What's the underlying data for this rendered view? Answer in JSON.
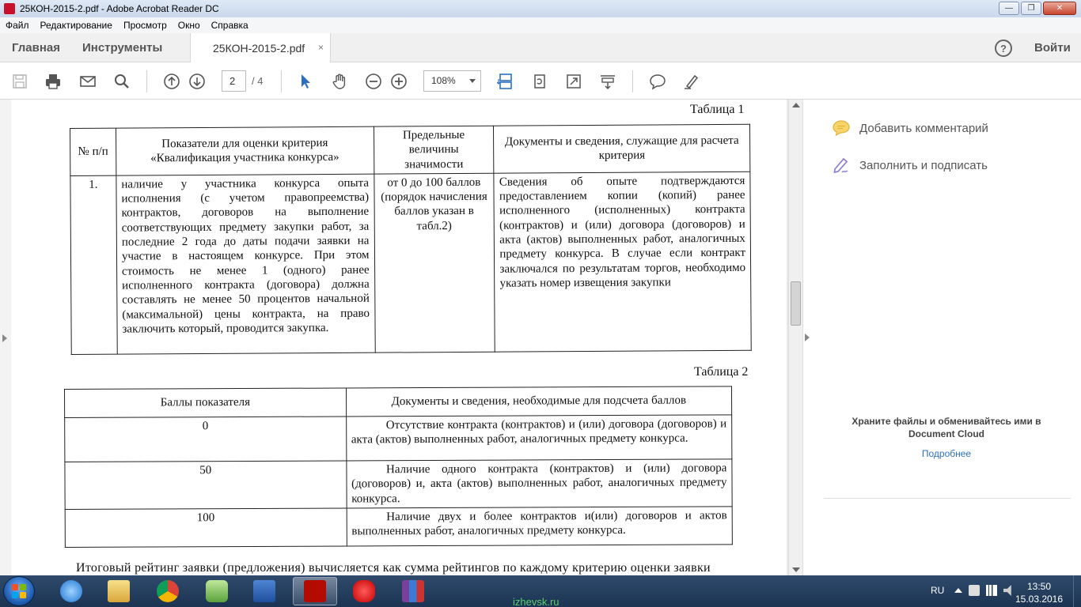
{
  "window": {
    "title": "25КОН-2015-2.pdf - Adobe Acrobat Reader DC",
    "minimize": "—",
    "maximize": "❐",
    "close": "✕"
  },
  "menu": [
    "Файл",
    "Редактирование",
    "Просмотр",
    "Окно",
    "Справка"
  ],
  "tabs": {
    "home": "Главная",
    "tools": "Инструменты",
    "document": "25КОН-2015-2.pdf",
    "close": "×"
  },
  "header": {
    "help": "?",
    "login": "Войти"
  },
  "toolbar": {
    "page_current": "2",
    "page_total": "/ 4",
    "zoom": "108%"
  },
  "document": {
    "table1_caption": "Таблица 1",
    "table1": {
      "headers": [
        "№ п/п",
        "Показатели для оценки критерия «Квалификация участника конкурса»",
        "Предельные величины значимости",
        "Документы и сведения, служащие для расчета критерия"
      ],
      "rows": [
        [
          "1.",
          "наличие у участника конкурса опыта исполнения (с учетом правопреемства) контрактов, договоров на выполнение соответствующих предмету закупки работ, за последние 2 года до даты подачи заявки на участие в настоящем конкурсе. При этом стоимость не менее 1 (одного) ранее исполненного контракта (договора) должна составлять не менее 50 процентов начальной (максимальной) цены контракта, на право заключить который, проводится закупка.",
          "от 0 до 100 баллов (порядок начисления баллов указан в табл.2)",
          "Сведения об опыте подтверждаются предоставлением копии (копий) ранее исполненного (исполненных) контракта (контрактов) и (или) договора (договоров) и акта (актов) выполненных работ, аналогичных предмету конкурса. В случае если контракт заключался по результатам торгов, необходимо указать номер извещения закупки"
        ]
      ]
    },
    "table2_caption": "Таблица 2",
    "table2": {
      "headers": [
        "Баллы показателя",
        "Документы и сведения, необходимые для подсчета баллов"
      ],
      "rows": [
        [
          "0",
          "Отсутствие контракта (контрактов) и (или) договора (договоров) и акта (актов) выполненных работ, аналогичных предмету конкурса."
        ],
        [
          "50",
          "Наличие одного контракта (контрактов) и (или) договора (договоров) и, акта (актов) выполненных работ, аналогичных предмету конкурса."
        ],
        [
          "100",
          "Наличие двух и более контрактов и(или) договоров и актов выполненных работ, аналогичных предмету конкурса."
        ]
      ]
    },
    "trailing_text": "Итоговый рейтинг заявки (предложения) вычисляется как сумма рейтингов по каждому критерию оценки заявки"
  },
  "right_panel": {
    "add_comment": "Добавить комментарий",
    "fill_sign": "Заполнить и подписать",
    "cloud_text": "Храните файлы и обменивайтесь ими в Document Cloud",
    "more": "Подробнее"
  },
  "taskbar": {
    "lang": "RU",
    "time": "13:50",
    "date": "15.03.2016",
    "watermark": "izhevsk.ru"
  },
  "colors": {
    "accent": "#2d6fbf",
    "comment_icon": "#f0c24a",
    "sign_icon": "#8a7fd1",
    "taskbar": "#1c3452"
  }
}
